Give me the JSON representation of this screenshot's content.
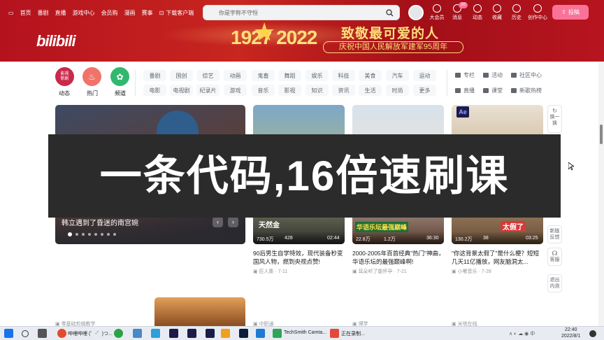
{
  "header": {
    "nav_left": [
      "首页",
      "番剧",
      "直播",
      "游戏中心",
      "会员购",
      "漫画",
      "赛事",
      "下载客户端"
    ],
    "search_placeholder": "你是宇称不守恒",
    "nav_right": [
      {
        "label": "大会员",
        "icon": "avatar-icon"
      },
      {
        "label": "消息",
        "badge": "20",
        "icon": "message-icon"
      },
      {
        "label": "动态",
        "icon": "dynamic-icon"
      },
      {
        "label": "收藏",
        "icon": "star-icon"
      },
      {
        "label": "历史",
        "icon": "clock-icon"
      },
      {
        "label": "创作中心",
        "icon": "bulb-icon"
      }
    ],
    "upload_label": "投稿"
  },
  "banner": {
    "logo": "bilibili",
    "year_span": "1927 2022",
    "slogan_main": "致敬最可爱的人",
    "slogan_sub": "庆祝中国人民解放军建军95周年"
  },
  "channels": {
    "primary": [
      {
        "label": "动态",
        "color": "#c9294a",
        "icon_text": "影视\n新剧"
      },
      {
        "label": "热门",
        "color": "#f0736a",
        "icon_text": "🔥"
      },
      {
        "label": "频道",
        "color": "#32b86e",
        "icon_text": "✿"
      }
    ],
    "row1": [
      "番剧",
      "国创",
      "综艺",
      "动画",
      "鬼畜",
      "舞蹈",
      "娱乐",
      "科技",
      "美食",
      "汽车",
      "运动"
    ],
    "row2": [
      "电影",
      "电视剧",
      "纪录片",
      "游戏",
      "音乐",
      "影视",
      "知识",
      "资讯",
      "生活",
      "时尚",
      "更多"
    ],
    "side": [
      "专栏",
      "活动",
      "社区中心",
      "直播",
      "课堂",
      "新歌热榜"
    ]
  },
  "feature": {
    "caption": "韩立遇到了昏迷的南宫婉"
  },
  "cards": [
    {
      "views": "730.5万",
      "danmaku": "428",
      "duration": "02:44",
      "title": "90后男生自学特效，现代装备秒变国风人物，燃到央视点赞!",
      "author": "匠人集",
      "date": "7-11"
    },
    {
      "views": "22.8万",
      "danmaku": "1.2万",
      "duration": "36:30",
      "title": "2000-2005年百首经典\"热门\"神曲，华语乐坛的最强巅峰啊!",
      "author": "耳朵听了能怀孕",
      "date": "7-21"
    },
    {
      "views": "130.2万",
      "danmaku": "38",
      "duration": "03:25",
      "title": "\"你这背景太假了\"是什么梗？短短几天11亿播放，网友脑洞太...",
      "author": "小嘟音乐",
      "date": "7-28"
    }
  ],
  "card_badge": "Ae",
  "overlays_text": [
    "华语乐坛最强巅峰",
    "太假了"
  ],
  "card_thumb_text": "天然金",
  "bottom_sources": [
    "零基础剪辑教学",
    "中职通",
    "博学",
    "米塔在线"
  ],
  "side_buttons": [
    "换一换",
    "新版反馈",
    "客服",
    "退出内测"
  ],
  "overlay": "一条代码,16倍速刷课",
  "taskbar": {
    "items": [
      "哔哩哔哩 (゜-゜)つ...",
      "TechSmith Camta...",
      "正在录制..."
    ],
    "time": "22:40",
    "date": "2022/8/1"
  }
}
